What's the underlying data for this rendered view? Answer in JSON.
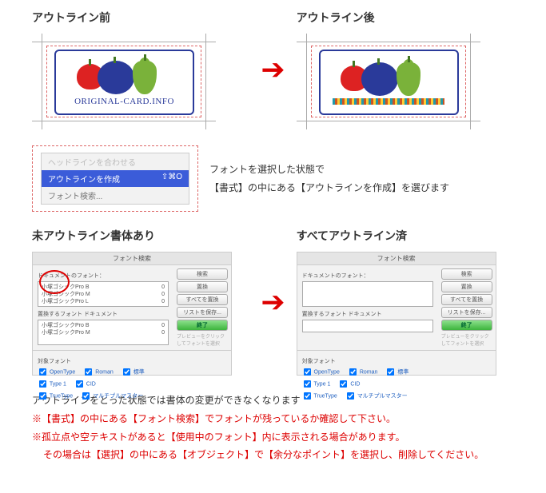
{
  "section1": {
    "before_title": "アウトライン前",
    "after_title": "アウトライン後",
    "card_text": "ORIGINAL-CARD.INFO"
  },
  "menu": {
    "item_gray": "ヘッドラインを合わせる",
    "item_selected": "アウトラインを作成",
    "item_selected_shortcut": "⇧⌘O",
    "item_last": "フォント検索...",
    "desc_line1": "フォントを選択した状態で",
    "desc_line2": "【書式】の中にある【アウトラインを作成】を選びます"
  },
  "section2": {
    "left_title": "未アウトライン書体あり",
    "right_title": "すべてアウトライン済",
    "dialog_title": "フォント検索",
    "lbl_doc_fonts": "ドキュメントのフォント：",
    "fonts": [
      {
        "name": "小塚ゴシックPro B",
        "mark": "0"
      },
      {
        "name": "小塚ゴシックPro M",
        "mark": "0"
      },
      {
        "name": "小塚ゴシックPro L",
        "mark": "0"
      }
    ],
    "lbl_replace": "置換するフォント",
    "lbl_doc": "ドキュメント",
    "btn_find": "検索",
    "btn_replace": "置換",
    "btn_replace_all": "すべてを置換",
    "btn_save_list": "リストを保存...",
    "btn_done": "終了",
    "tiny_note": "プレビューをクリックしてフォントを選択",
    "lbl_target": "対象フォント",
    "chk_opentype": "OpenType",
    "chk_roman": "Roman",
    "chk_std": "標準",
    "chk_type1": "Type 1",
    "chk_cid": "CID",
    "chk_truetype": "TrueType",
    "chk_mm": "マルチプルマスター"
  },
  "notes": {
    "line1": "アウトラインをとった状態では書体の変更ができなくなります",
    "line2": "※【書式】の中にある【フォント検索】でフォントが残っているか確認して下さい。",
    "line3": "※孤立点や空テキストがあると【使用中のフォント】内に表示される場合があります。",
    "line4": "その場合は【選択】の中にある【オブジェクト】で【余分なポイント】を選択し、削除してください。"
  }
}
